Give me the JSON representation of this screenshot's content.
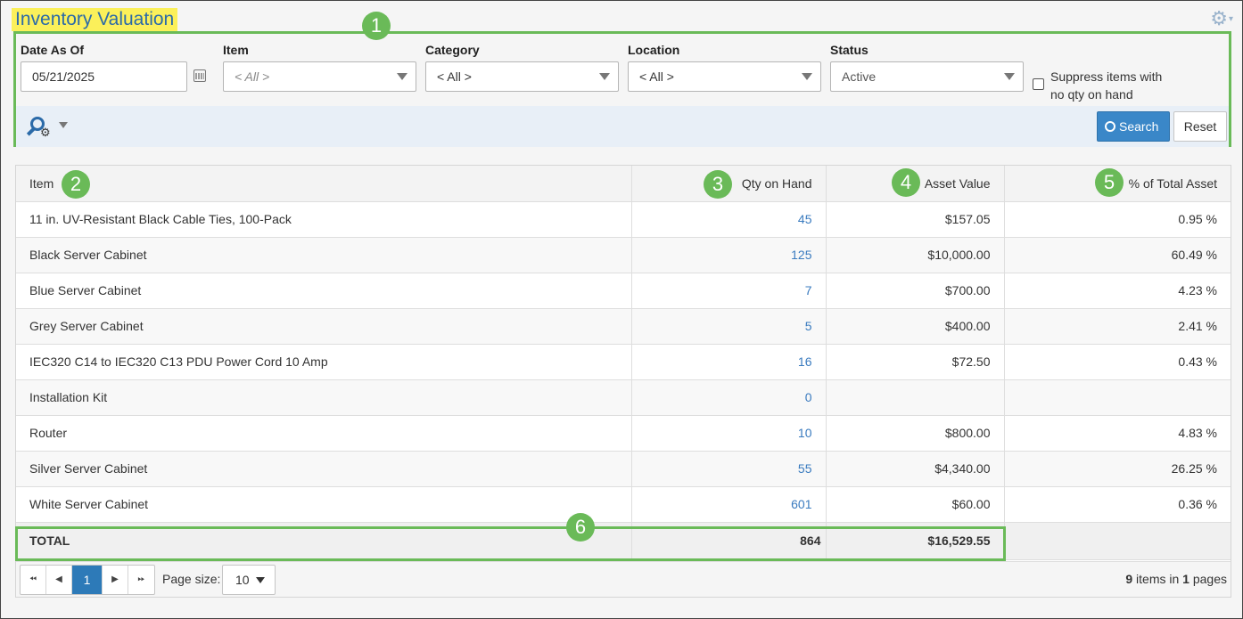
{
  "page": {
    "title": "Inventory Valuation"
  },
  "callouts": [
    "1",
    "2",
    "3",
    "4",
    "5",
    "6"
  ],
  "filters": {
    "date_label": "Date As Of",
    "date_value": "05/21/2025",
    "item_label": "Item",
    "item_value": "< All >",
    "category_label": "Category",
    "category_value": "< All >",
    "location_label": "Location",
    "location_value": "< All >",
    "status_label": "Status",
    "status_value": "Active",
    "suppress_line1": "Suppress items with",
    "suppress_line2": "no qty on hand",
    "suppress_checked": false,
    "search_label": "Search",
    "reset_label": "Reset"
  },
  "grid": {
    "headers": [
      "Item",
      "Qty on Hand",
      "Asset Value",
      "% of Total Asset"
    ],
    "rows": [
      [
        "11 in. UV-Resistant Black Cable Ties, 100-Pack",
        "45",
        "$157.05",
        "0.95 %"
      ],
      [
        "Black Server Cabinet",
        "125",
        "$10,000.00",
        "60.49 %"
      ],
      [
        "Blue Server Cabinet",
        "7",
        "$700.00",
        "4.23 %"
      ],
      [
        "Grey Server Cabinet",
        "5",
        "$400.00",
        "2.41 %"
      ],
      [
        "IEC320 C14 to IEC320 C13 PDU Power Cord 10 Amp",
        "16",
        "$72.50",
        "0.43 %"
      ],
      [
        "Installation Kit",
        "0",
        "",
        ""
      ],
      [
        "Router",
        "10",
        "$800.00",
        "4.83 %"
      ],
      [
        "Silver Server Cabinet",
        "55",
        "$4,340.00",
        "26.25 %"
      ],
      [
        "White Server Cabinet",
        "601",
        "$60.00",
        "0.36 %"
      ]
    ],
    "total": {
      "label": "TOTAL",
      "qty": "864",
      "value": "$16,529.55",
      "percent": ""
    }
  },
  "pager": {
    "current_page": "1",
    "page_size_label": "Page size:",
    "page_size": "10",
    "item_count": "9",
    "items_in_text": " items in ",
    "page_count": "1",
    "pages_text": " pages"
  },
  "colors": {
    "accent": "#3a87c8",
    "callout": "#6aba58",
    "title_highlight": "#fbf05a",
    "link": "#3a7bbf"
  },
  "icons": [
    "gear-icon",
    "calendar-icon",
    "search-tools-icon",
    "search-icon",
    "first-page-icon",
    "prev-page-icon",
    "next-page-icon",
    "last-page-icon"
  ]
}
